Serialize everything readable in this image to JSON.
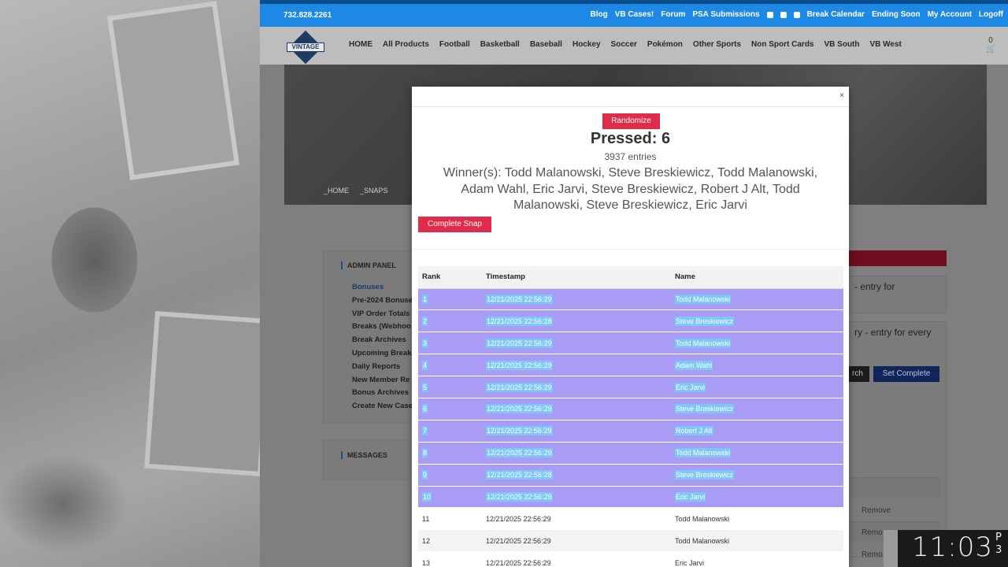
{
  "topbar": {
    "phone": "732.828.2261",
    "links": [
      "Blog",
      "VB Cases!",
      "Forum",
      "PSA Submissions"
    ],
    "links2": [
      "Break Calendar",
      "Ending Soon",
      "My Account",
      "Logoff"
    ]
  },
  "logo": {
    "text": "VINTAGE"
  },
  "nav": [
    "HOME",
    "All Products",
    "Football",
    "Basketball",
    "Baseball",
    "Hockey",
    "Soccer",
    "Pokémon",
    "Other Sports",
    "Non Sport Cards",
    "VB South",
    "VB West"
  ],
  "cart": {
    "count": "0"
  },
  "breadcrumb": {
    "home": "_HOME",
    "snaps": "_SNAPS"
  },
  "admin": {
    "title": "ADMIN PANEL",
    "items": [
      "Bonuses",
      "Pre-2024 Bonuse",
      "VIP Order Totals",
      "Breaks (Webhoo",
      "Break Archives",
      "Upcoming Break",
      "Daily Reports",
      "New Member Re",
      "Bonus Archives",
      "Create New Case"
    ]
  },
  "messages": {
    "title": "MESSAGES"
  },
  "right": {
    "text1": "- entry for",
    "text2": "ry - entry for every",
    "search": "rch",
    "set_complete": "Set Complete",
    "remove": "Remove",
    "remove2": "Remo",
    "remove3": "Remo"
  },
  "modal": {
    "close": "×",
    "randomize": "Randomize",
    "pressed": "Pressed: 6",
    "entries": "3937 entries",
    "winners": "Winner(s): Todd Malanowski, Steve Breskiewicz, Todd Malanowski, Adam Wahl, Eric Jarvi, Steve Breskiewicz, Robert J Alt, Todd Malanowski, Steve Breskiewicz, Eric Jarvi",
    "complete": "Complete Snap",
    "columns": [
      "Rank",
      "Timestamp",
      "Name"
    ],
    "rows": [
      {
        "rank": "1",
        "ts": "12/21/2025 22:56:29",
        "name": "Todd Malanowski"
      },
      {
        "rank": "2",
        "ts": "12/21/2025 22:56:28",
        "name": "Steve Breskiewicz"
      },
      {
        "rank": "3",
        "ts": "12/21/2025 22:56:29",
        "name": "Todd Malanowski"
      },
      {
        "rank": "4",
        "ts": "12/21/2025 22:56:29",
        "name": "Adam Wahl"
      },
      {
        "rank": "5",
        "ts": "12/21/2025 22:56:29",
        "name": "Eric Jarvi"
      },
      {
        "rank": "6",
        "ts": "12/21/2025 22:56:29",
        "name": "Steve Breskiewicz"
      },
      {
        "rank": "7",
        "ts": "12/21/2025 22:56:29",
        "name": "Robert J Alt"
      },
      {
        "rank": "8",
        "ts": "12/21/2025 22:56:29",
        "name": "Todd Malanowski"
      },
      {
        "rank": "9",
        "ts": "12/21/2025 22:56:28",
        "name": "Steve Breskiewicz"
      },
      {
        "rank": "10",
        "ts": "12/21/2025 22:56:29",
        "name": "Eric Jarvi"
      },
      {
        "rank": "11",
        "ts": "12/21/2025 22:56:29",
        "name": "Todd Malanowski"
      },
      {
        "rank": "12",
        "ts": "12/21/2025 22:56:29",
        "name": "Todd Malanowski"
      },
      {
        "rank": "13",
        "ts": "12/21/2025 22:56:29",
        "name": "Eric Jarvi"
      }
    ],
    "selected_count": 10
  },
  "clock": {
    "time": "11:03",
    "ampm1": "P",
    "ampm2": "3"
  },
  "colors": {
    "accent": "#1e88e5",
    "button": "#e02c4a",
    "selection": "#a89cf5",
    "text_highlight": "#7fc7f7"
  }
}
